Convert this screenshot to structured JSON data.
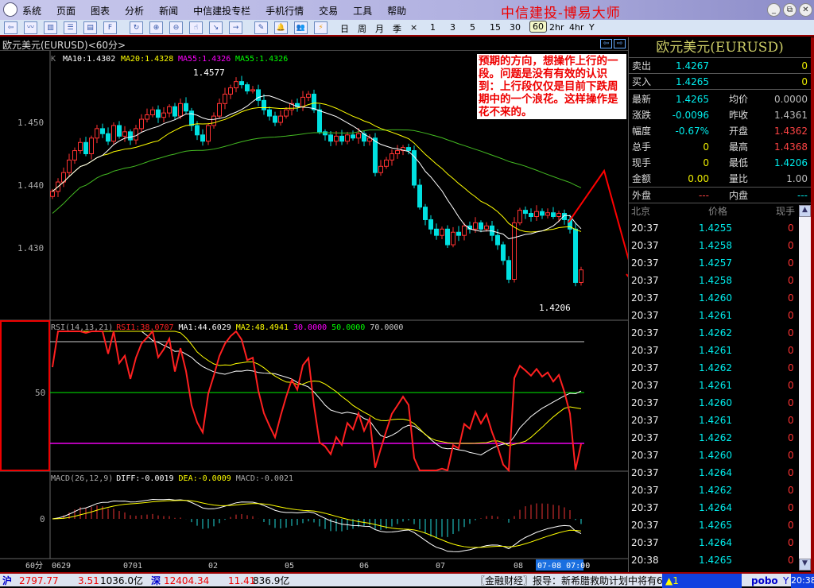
{
  "menu": [
    "系统",
    "页面",
    "图表",
    "分析",
    "新闻",
    "中信建投专栏",
    "手机行情",
    "交易",
    "工具",
    "帮助"
  ],
  "brand": "中信建投-博易大师",
  "window_controls": {
    "minimize": "_",
    "restore": "⧉",
    "close": "✕"
  },
  "toolbar": {
    "periods": [
      "日",
      "周",
      "月",
      "季",
      "×",
      "1",
      "3",
      "5",
      "15",
      "30",
      "60",
      "2hr",
      "4hr",
      "Y"
    ],
    "selected_period": "60"
  },
  "chart": {
    "header": "欧元美元(EURUSD)<60分>",
    "ma_legend": {
      "k": "K",
      "ma10": "MA10:1.4302",
      "ma20": "MA20:1.4328",
      "ma55a": "MA55:1.4326",
      "ma55b": "MA55:1.4326"
    },
    "high_label": "1.4577",
    "low_label": "1.4206",
    "y_ticks": [
      "1.450",
      "1.440",
      "1.430"
    ],
    "rsi_legend": {
      "name": "RSI(14,13,21)",
      "rsi1": "RSI1:38.0707",
      "ma1": "MA1:44.6029",
      "ma2": "MA2:48.4941",
      "l30": "30.0000",
      "l50": "50.0000",
      "l70": "70.0000"
    },
    "rsi_tick": "50",
    "macd_legend": {
      "name": "MACD(26,12,9)",
      "diff": "DIFF:-0.0019",
      "dea": "DEA:-0.0009",
      "macd": "MACD:-0.0021"
    },
    "macd_tick": "0",
    "x_axis": {
      "period": "60分",
      "labels": [
        "0629",
        "0701",
        "02",
        "05",
        "06",
        "07",
        "08"
      ],
      "cursor": "07-08 07:00"
    },
    "annotation": "预期的方向，想操作上行的一段。问题是没有有效的认识到：上行段仅仅是目前下跌周期中的一个浪花。这样操作是花不来的。",
    "colors": {
      "up": "#ff3232",
      "down": "#00e0e0",
      "ma10": "#ffffff",
      "ma20": "#ffff00",
      "ma55": "#44bb22",
      "rsi": "#ff2020",
      "annotation": "#ff0000"
    }
  },
  "chart_data": {
    "type": "candlestick",
    "closes": [
      1.439,
      1.4405,
      1.442,
      1.444,
      1.4455,
      1.4468,
      1.445,
      1.4475,
      1.449,
      1.4482,
      1.447,
      1.4495,
      1.4478,
      1.4485,
      1.4472,
      1.449,
      1.4505,
      1.4512,
      1.452,
      1.4508,
      1.4515,
      1.4525,
      1.451,
      1.453,
      1.4518,
      1.4495,
      1.448,
      1.447,
      1.4495,
      1.451,
      1.453,
      1.4545,
      1.4555,
      1.4565,
      1.456,
      1.455,
      1.4552,
      1.4535,
      1.452,
      1.451,
      1.45,
      1.451,
      1.452,
      1.453,
      1.4525,
      1.454,
      1.4545,
      1.452,
      1.4485,
      1.448,
      1.447,
      1.4478,
      1.447,
      1.448,
      1.4475,
      1.4482,
      1.447,
      1.4475,
      1.442,
      1.443,
      1.444,
      1.445,
      1.4455,
      1.446,
      1.4455,
      1.44,
      1.4365,
      1.4345,
      1.433,
      1.432,
      1.433,
      1.4305,
      1.4325,
      1.432,
      1.4335,
      1.433,
      1.434,
      1.433,
      1.4335,
      1.432,
      1.4305,
      1.428,
      1.425,
      1.434,
      1.436,
      1.4355,
      1.435,
      1.4358,
      1.4352,
      1.4356,
      1.435,
      1.4355,
      1.4345,
      1.433,
      1.4245,
      1.4265
    ],
    "ylim": [
      1.4195,
      1.4595
    ],
    "high": 1.4577,
    "low": 1.4206
  },
  "quote": {
    "title": "欧元美元(EURUSD)",
    "sell": {
      "label": "卖出",
      "price": "1.4267",
      "vol": "0"
    },
    "buy": {
      "label": "买入",
      "price": "1.4265",
      "vol": "0"
    },
    "rows": [
      {
        "l": "最新",
        "v": "1.4265",
        "vc": "#0ee",
        "l2": "均价",
        "v2": "0.0000",
        "v2c": "#bbb"
      },
      {
        "l": "涨跌",
        "v": "-0.0096",
        "vc": "#0ee",
        "l2": "昨收",
        "v2": "1.4361",
        "v2c": "#bbb"
      },
      {
        "l": "幅度",
        "v": "-0.67%",
        "vc": "#0ee",
        "l2": "开盘",
        "v2": "1.4362",
        "v2c": "#f44"
      },
      {
        "l": "总手",
        "v": "0",
        "vc": "#ee0",
        "l2": "最高",
        "v2": "1.4368",
        "v2c": "#f44"
      },
      {
        "l": "现手",
        "v": "0",
        "vc": "#ee0",
        "l2": "最低",
        "v2": "1.4206",
        "v2c": "#0ee"
      },
      {
        "l": "金额",
        "v": "0.00",
        "vc": "#ee0",
        "l2": "量比",
        "v2": "1.00",
        "v2c": "#bbb"
      }
    ],
    "outer": {
      "label": "外盘",
      "value": "---",
      "label2": "内盘",
      "value2": "---"
    },
    "tick_header": [
      "北京",
      "价格",
      "现手"
    ],
    "ticks": [
      [
        "20:37",
        "1.4255",
        "0"
      ],
      [
        "20:37",
        "1.4258",
        "0"
      ],
      [
        "20:37",
        "1.4257",
        "0"
      ],
      [
        "20:37",
        "1.4258",
        "0"
      ],
      [
        "20:37",
        "1.4260",
        "0"
      ],
      [
        "20:37",
        "1.4261",
        "0"
      ],
      [
        "20:37",
        "1.4262",
        "0"
      ],
      [
        "20:37",
        "1.4261",
        "0"
      ],
      [
        "20:37",
        "1.4262",
        "0"
      ],
      [
        "20:37",
        "1.4261",
        "0"
      ],
      [
        "20:37",
        "1.4260",
        "0"
      ],
      [
        "20:37",
        "1.4261",
        "0"
      ],
      [
        "20:37",
        "1.4262",
        "0"
      ],
      [
        "20:37",
        "1.4260",
        "0"
      ],
      [
        "20:37",
        "1.4264",
        "0"
      ],
      [
        "20:37",
        "1.4262",
        "0"
      ],
      [
        "20:37",
        "1.4264",
        "0"
      ],
      [
        "20:37",
        "1.4265",
        "0"
      ],
      [
        "20:37",
        "1.4264",
        "0"
      ],
      [
        "20:38",
        "1.4265",
        "0"
      ]
    ]
  },
  "status": {
    "sh_label": "沪",
    "sh_index": "2797.77",
    "sh_change": "3.51",
    "sh_amount": "1036.0亿",
    "sz_label": "深",
    "sz_index": "12404.34",
    "sz_change": "11.41",
    "sz_amount": "836.9亿",
    "news": "〖金融财经〗报导：新希腊救助计划中将有6",
    "alert": "1",
    "logo": "pobo",
    "clock": "20:38"
  }
}
